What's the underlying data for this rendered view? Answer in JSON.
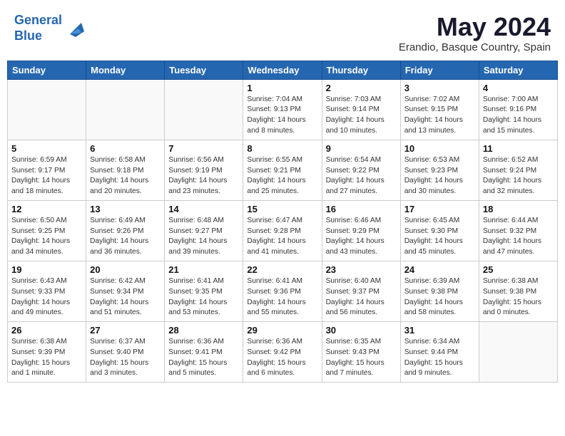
{
  "header": {
    "logo_line1": "General",
    "logo_line2": "Blue",
    "month_year": "May 2024",
    "location": "Erandio, Basque Country, Spain"
  },
  "weekdays": [
    "Sunday",
    "Monday",
    "Tuesday",
    "Wednesday",
    "Thursday",
    "Friday",
    "Saturday"
  ],
  "weeks": [
    [
      {
        "day": "",
        "info": ""
      },
      {
        "day": "",
        "info": ""
      },
      {
        "day": "",
        "info": ""
      },
      {
        "day": "1",
        "info": "Sunrise: 7:04 AM\nSunset: 9:13 PM\nDaylight: 14 hours\nand 8 minutes."
      },
      {
        "day": "2",
        "info": "Sunrise: 7:03 AM\nSunset: 9:14 PM\nDaylight: 14 hours\nand 10 minutes."
      },
      {
        "day": "3",
        "info": "Sunrise: 7:02 AM\nSunset: 9:15 PM\nDaylight: 14 hours\nand 13 minutes."
      },
      {
        "day": "4",
        "info": "Sunrise: 7:00 AM\nSunset: 9:16 PM\nDaylight: 14 hours\nand 15 minutes."
      }
    ],
    [
      {
        "day": "5",
        "info": "Sunrise: 6:59 AM\nSunset: 9:17 PM\nDaylight: 14 hours\nand 18 minutes."
      },
      {
        "day": "6",
        "info": "Sunrise: 6:58 AM\nSunset: 9:18 PM\nDaylight: 14 hours\nand 20 minutes."
      },
      {
        "day": "7",
        "info": "Sunrise: 6:56 AM\nSunset: 9:19 PM\nDaylight: 14 hours\nand 23 minutes."
      },
      {
        "day": "8",
        "info": "Sunrise: 6:55 AM\nSunset: 9:21 PM\nDaylight: 14 hours\nand 25 minutes."
      },
      {
        "day": "9",
        "info": "Sunrise: 6:54 AM\nSunset: 9:22 PM\nDaylight: 14 hours\nand 27 minutes."
      },
      {
        "day": "10",
        "info": "Sunrise: 6:53 AM\nSunset: 9:23 PM\nDaylight: 14 hours\nand 30 minutes."
      },
      {
        "day": "11",
        "info": "Sunrise: 6:52 AM\nSunset: 9:24 PM\nDaylight: 14 hours\nand 32 minutes."
      }
    ],
    [
      {
        "day": "12",
        "info": "Sunrise: 6:50 AM\nSunset: 9:25 PM\nDaylight: 14 hours\nand 34 minutes."
      },
      {
        "day": "13",
        "info": "Sunrise: 6:49 AM\nSunset: 9:26 PM\nDaylight: 14 hours\nand 36 minutes."
      },
      {
        "day": "14",
        "info": "Sunrise: 6:48 AM\nSunset: 9:27 PM\nDaylight: 14 hours\nand 39 minutes."
      },
      {
        "day": "15",
        "info": "Sunrise: 6:47 AM\nSunset: 9:28 PM\nDaylight: 14 hours\nand 41 minutes."
      },
      {
        "day": "16",
        "info": "Sunrise: 6:46 AM\nSunset: 9:29 PM\nDaylight: 14 hours\nand 43 minutes."
      },
      {
        "day": "17",
        "info": "Sunrise: 6:45 AM\nSunset: 9:30 PM\nDaylight: 14 hours\nand 45 minutes."
      },
      {
        "day": "18",
        "info": "Sunrise: 6:44 AM\nSunset: 9:32 PM\nDaylight: 14 hours\nand 47 minutes."
      }
    ],
    [
      {
        "day": "19",
        "info": "Sunrise: 6:43 AM\nSunset: 9:33 PM\nDaylight: 14 hours\nand 49 minutes."
      },
      {
        "day": "20",
        "info": "Sunrise: 6:42 AM\nSunset: 9:34 PM\nDaylight: 14 hours\nand 51 minutes."
      },
      {
        "day": "21",
        "info": "Sunrise: 6:41 AM\nSunset: 9:35 PM\nDaylight: 14 hours\nand 53 minutes."
      },
      {
        "day": "22",
        "info": "Sunrise: 6:41 AM\nSunset: 9:36 PM\nDaylight: 14 hours\nand 55 minutes."
      },
      {
        "day": "23",
        "info": "Sunrise: 6:40 AM\nSunset: 9:37 PM\nDaylight: 14 hours\nand 56 minutes."
      },
      {
        "day": "24",
        "info": "Sunrise: 6:39 AM\nSunset: 9:38 PM\nDaylight: 14 hours\nand 58 minutes."
      },
      {
        "day": "25",
        "info": "Sunrise: 6:38 AM\nSunset: 9:38 PM\nDaylight: 15 hours\nand 0 minutes."
      }
    ],
    [
      {
        "day": "26",
        "info": "Sunrise: 6:38 AM\nSunset: 9:39 PM\nDaylight: 15 hours\nand 1 minute."
      },
      {
        "day": "27",
        "info": "Sunrise: 6:37 AM\nSunset: 9:40 PM\nDaylight: 15 hours\nand 3 minutes."
      },
      {
        "day": "28",
        "info": "Sunrise: 6:36 AM\nSunset: 9:41 PM\nDaylight: 15 hours\nand 5 minutes."
      },
      {
        "day": "29",
        "info": "Sunrise: 6:36 AM\nSunset: 9:42 PM\nDaylight: 15 hours\nand 6 minutes."
      },
      {
        "day": "30",
        "info": "Sunrise: 6:35 AM\nSunset: 9:43 PM\nDaylight: 15 hours\nand 7 minutes."
      },
      {
        "day": "31",
        "info": "Sunrise: 6:34 AM\nSunset: 9:44 PM\nDaylight: 15 hours\nand 9 minutes."
      },
      {
        "day": "",
        "info": ""
      }
    ]
  ]
}
